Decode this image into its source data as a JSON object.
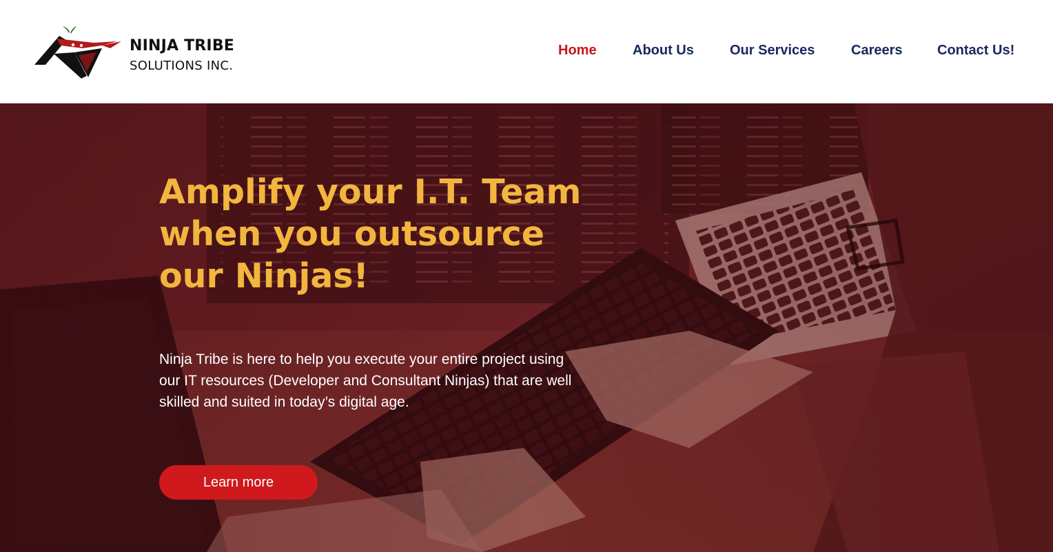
{
  "brand": {
    "name_line1": "NINJA TRIBE",
    "name_line2": "SOLUTIONS INC.",
    "logo_icon": "ninja-mask-icon"
  },
  "nav": {
    "items": [
      {
        "label": "Home",
        "active": true
      },
      {
        "label": "About Us",
        "active": false
      },
      {
        "label": "Our Services",
        "active": false
      },
      {
        "label": "Careers",
        "active": false
      },
      {
        "label": "Contact Us!",
        "active": false
      }
    ]
  },
  "hero": {
    "headline": "Amplify your I.T. Team\nwhen  you outsource\nour Ninjas!",
    "description": "Ninja Tribe is here to help you execute your entire project using our IT resources (Developer and Consultant Ninjas) that are well skilled and suited in today’s digital age.",
    "cta_label": "Learn more",
    "background_image": "developer-typing-on-keyboard-photo"
  },
  "colors": {
    "nav_text": "#16285e",
    "nav_active": "#c8151b",
    "headline": "#f2b63f",
    "hero_tint": "#6a1a20",
    "cta_bg": "#d0191c"
  }
}
